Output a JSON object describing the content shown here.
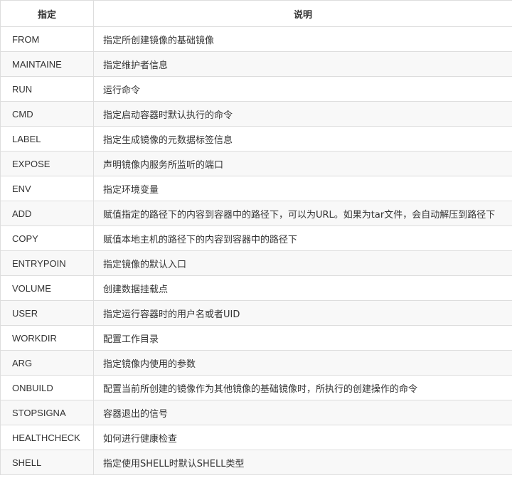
{
  "table": {
    "headers": [
      "指定",
      "说明"
    ],
    "rows": [
      {
        "cmd": "FROM",
        "desc": "指定所创建镜像的基础镜像"
      },
      {
        "cmd": "MAINTAINE",
        "desc": "指定维护者信息"
      },
      {
        "cmd": "RUN",
        "desc": "运行命令"
      },
      {
        "cmd": "CMD",
        "desc": "指定启动容器时默认执行的命令"
      },
      {
        "cmd": "LABEL",
        "desc": "指定生成镜像的元数据标签信息"
      },
      {
        "cmd": "EXPOSE",
        "desc": "声明镜像内服务所监听的端口"
      },
      {
        "cmd": "ENV",
        "desc": "指定环境变量"
      },
      {
        "cmd": "ADD",
        "desc": "赋值指定的路径下的内容到容器中的路径下，可以为URL。如果为tar文件，会自动解压到路径下"
      },
      {
        "cmd": "COPY",
        "desc": "赋值本地主机的路径下的内容到容器中的路径下"
      },
      {
        "cmd": "ENTRYPOIN",
        "desc": "指定镜像的默认入口"
      },
      {
        "cmd": "VOLUME",
        "desc": "创建数据挂载点"
      },
      {
        "cmd": "USER",
        "desc": "指定运行容器时的用户名或者UID"
      },
      {
        "cmd": "WORKDIR",
        "desc": "配置工作目录"
      },
      {
        "cmd": "ARG",
        "desc": "指定镜像内使用的参数"
      },
      {
        "cmd": "ONBUILD",
        "desc": "配置当前所创建的镜像作为其他镜像的基础镜像时，所执行的创建操作的命令"
      },
      {
        "cmd": "STOPSIGNA",
        "desc": "容器退出的信号"
      },
      {
        "cmd": "HEALTHCHECK",
        "desc": "如何进行健康检查"
      },
      {
        "cmd": "SHELL",
        "desc": "指定使用SHELL时默认SHELL类型"
      }
    ]
  }
}
